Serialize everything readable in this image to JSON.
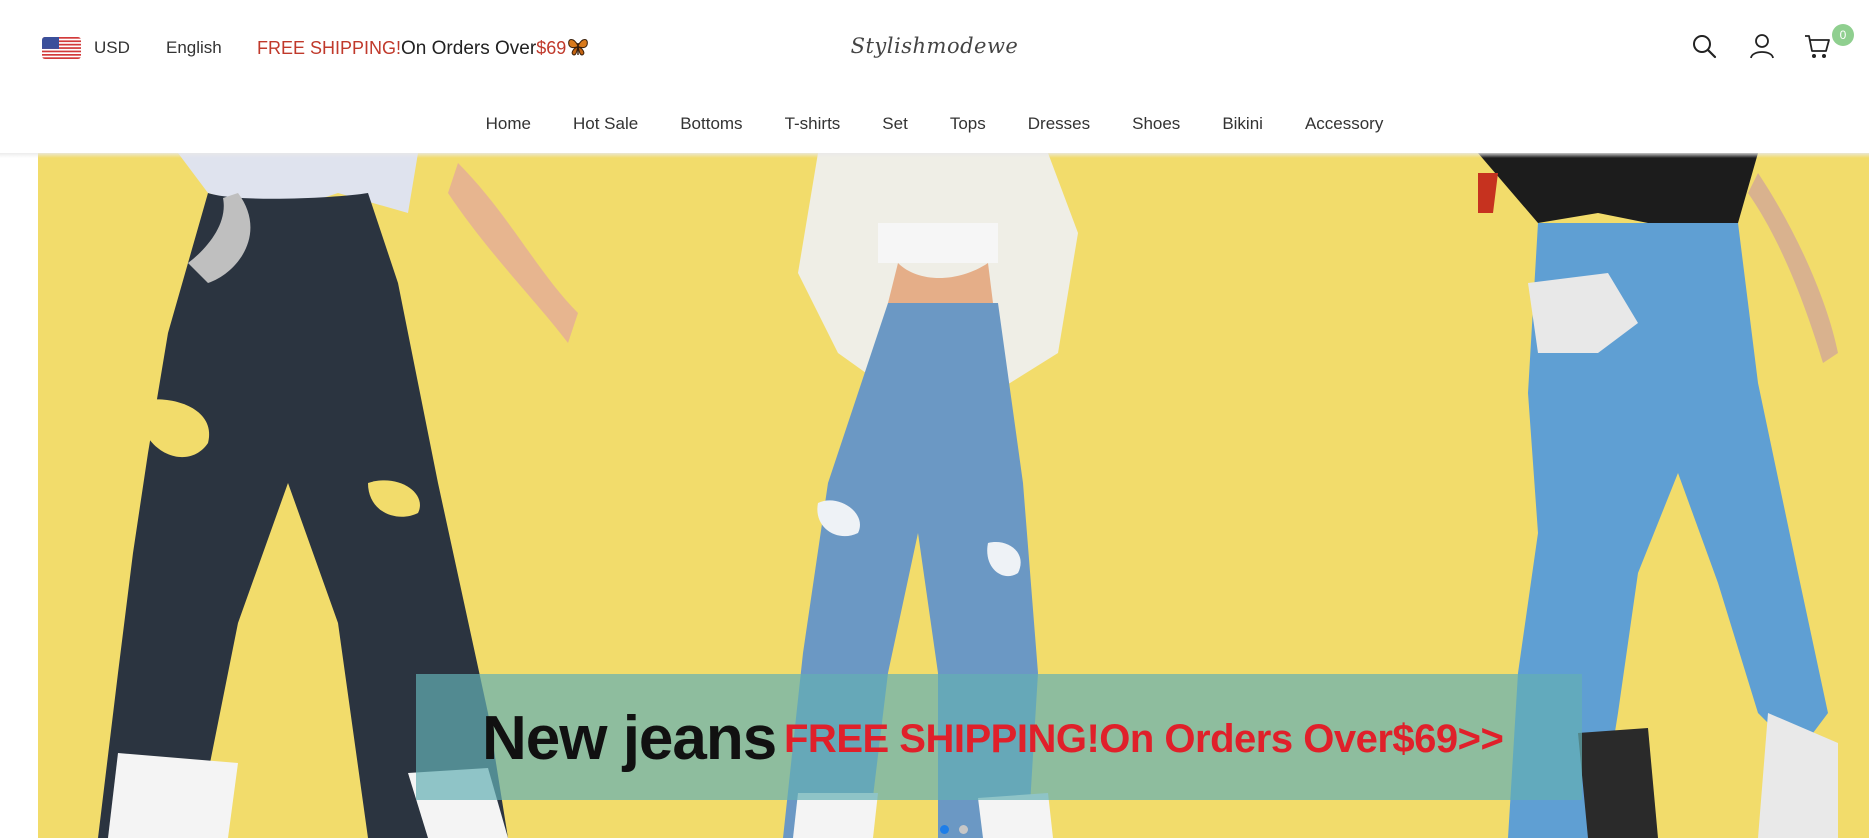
{
  "topbar": {
    "currency": "USD",
    "language": "English",
    "promo_red": "FREE SHIPPING!",
    "promo_dark": "On Orders Over",
    "promo_amount": "$69",
    "promo_icon": "butterfly-icon"
  },
  "brand": {
    "logo_text": "Stylishmodewe"
  },
  "header_icons": {
    "search": "search-icon",
    "account": "user-icon",
    "cart": "cart-icon",
    "cart_count": "0",
    "cart_badge_color": "#8fcf8f"
  },
  "nav": {
    "items": [
      "Home",
      "Hot Sale",
      "Bottoms",
      "T-shirts",
      "Set",
      "Tops",
      "Dresses",
      "Shoes",
      "Bikini",
      "Accessory"
    ]
  },
  "banner": {
    "background_color": "#f2dc6b",
    "headline": "New jeans",
    "subline": "FREE SHIPPING!On Orders Over$69>>",
    "slides": 2,
    "active_slide": 1,
    "accent_red": "#e0202a",
    "dot_active_color": "#1e7ee8"
  }
}
